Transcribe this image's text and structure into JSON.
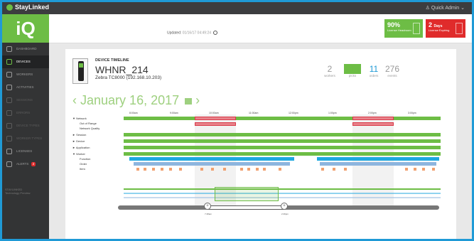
{
  "app": {
    "brand": "StayLinked",
    "user": "Quick Admin",
    "logo": "iQ"
  },
  "sidebar": {
    "items": [
      {
        "label": "DASHBOARD",
        "icon": "dashboard-icon"
      },
      {
        "label": "DEVICES",
        "icon": "device-icon"
      },
      {
        "label": "WORKERS",
        "icon": "worker-icon"
      },
      {
        "label": "ACTIVITIES",
        "icon": "chart-icon"
      },
      {
        "label": "SESSIONS",
        "icon": "session-icon"
      },
      {
        "label": "ERRORS",
        "icon": "error-icon"
      },
      {
        "label": "DEVICE TYPES",
        "icon": "list-icon"
      },
      {
        "label": "WORKER TYPES",
        "icon": "type-icon"
      },
      {
        "label": "LICENSES",
        "icon": "license-icon"
      },
      {
        "label": "ALERTS",
        "icon": "alert-icon",
        "badge": "2"
      }
    ],
    "footer_line1": "STAYLINKED",
    "footer_line2": "Technology Preview"
  },
  "header": {
    "updated_label": "Updated:",
    "updated_time": "01/16/17 04:49:24"
  },
  "cards": {
    "license_headroom": {
      "value": "90%",
      "label": "License Headroom",
      "color": "#6dbd45"
    },
    "license_expiring": {
      "value": "2",
      "unit": "Days",
      "label": "License Expiring",
      "color": "#e02b2b"
    }
  },
  "device": {
    "section_label": "DEVICE TIMELINE",
    "name": "WHNR_214",
    "model": "Zebra TC8000 (192.168.10.203)"
  },
  "stats": [
    {
      "value": "2",
      "label": "workers",
      "color": "gray"
    },
    {
      "value": "214",
      "label": "picks",
      "color": "green"
    },
    {
      "value": "11",
      "label": "orders",
      "color": "blue"
    },
    {
      "value": "276",
      "label": "events",
      "color": "gray"
    }
  ],
  "date_nav": {
    "prev": "‹",
    "date": "January 16, 2017",
    "next": "›"
  },
  "timeline": {
    "hours": [
      "8:00am",
      "9:00am",
      "10:00am",
      "11:00am",
      "12:00pm",
      "1:00pm",
      "2:00pm",
      "3:00pm"
    ],
    "rows": [
      {
        "label": "▼ Network"
      },
      {
        "label": "Out of Range"
      },
      {
        "label": "Network Quality"
      },
      {
        "label": "► Session"
      },
      {
        "label": "► Device"
      },
      {
        "label": "► Application"
      },
      {
        "label": "▼ Worker"
      },
      {
        "label": "Function"
      },
      {
        "label": "Order"
      },
      {
        "label": "Item"
      }
    ]
  },
  "range": {
    "start_label": "7:48am",
    "end_label": "2:49pm"
  }
}
